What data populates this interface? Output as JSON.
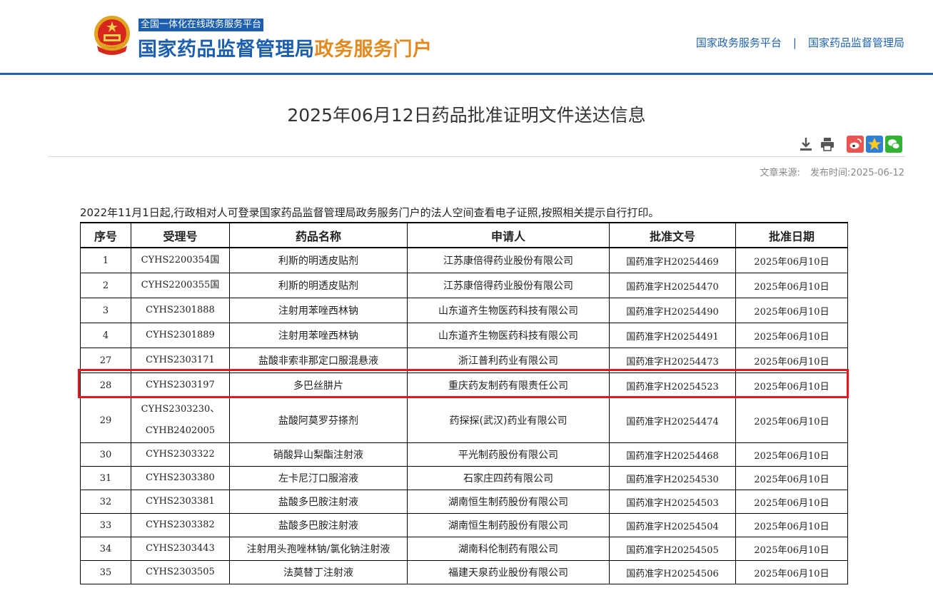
{
  "header": {
    "portal_tag": "全国一体化在线政务服务平台",
    "site_name_blue": "国家药品监督管理局",
    "site_name_orange": "政务服务门户",
    "links": [
      "国家政务服务平台",
      "国家药品监督管理局"
    ],
    "link_separator": "|"
  },
  "colors": {
    "brand_blue": "#1c5fb0",
    "accent_orange": "#e38a1e",
    "highlight_red": "#e8161c"
  },
  "article": {
    "title": "2025年06月12日药品批准证明文件送达信息",
    "source_label": "文章来源:",
    "published_label": "发布时间:",
    "published_date": "2025-06-12",
    "share_icons": [
      "download-icon",
      "print-icon",
      "weibo-icon",
      "qzone-icon",
      "wechat-icon"
    ]
  },
  "notice": "2022年11月1日起,行政相对人可登录国家药品监督管理局政务服务门户的法人空间查看电子证照,按照相关提示自行打印。",
  "table": {
    "headers": [
      "序号",
      "受理号",
      "药品名称",
      "申请人",
      "批准文号",
      "批准日期"
    ],
    "rows": [
      [
        "1",
        "CYHS2200354国",
        "利斯的明透皮贴剂",
        "江苏康倍得药业股份有限公司",
        "国药准字H20254469",
        "2025年06月10日"
      ],
      [
        "2",
        "CYHS2200355国",
        "利斯的明透皮贴剂",
        "江苏康倍得药业股份有限公司",
        "国药准字H20254470",
        "2025年06月10日"
      ],
      [
        "3",
        "CYHS2301888",
        "注射用苯唑西林钠",
        "山东道齐生物医药科技有限公司",
        "国药准字H20254490",
        "2025年06月10日"
      ],
      [
        "4",
        "CYHS2301889",
        "注射用苯唑西林钠",
        "山东道齐生物医药科技有限公司",
        "国药准字H20254491",
        "2025年06月10日"
      ],
      [
        "27",
        "CYHS2303171",
        "盐酸非索非那定口服混悬液",
        "浙江普利药业有限公司",
        "国药准字H20254473",
        "2025年06月10日"
      ],
      [
        "28",
        "CYHS2303197",
        "多巴丝肼片",
        "重庆药友制药有限责任公司",
        "国药准字H20254523",
        "2025年06月10日"
      ],
      [
        "29",
        "CYHS2303230、\nCYHB2402005",
        "盐酸阿莫罗芬搽剂",
        "药探探(武汉)药业有限公司",
        "国药准字H20254474",
        "2025年06月10日"
      ],
      [
        "30",
        "CYHS2303322",
        "硝酸异山梨酯注射液",
        "平光制药股份有限公司",
        "国药准字H20254468",
        "2025年06月10日"
      ],
      [
        "31",
        "CYHS2303380",
        "左卡尼汀口服溶液",
        "石家庄四药有限公司",
        "国药准字H20254530",
        "2025年06月10日"
      ],
      [
        "32",
        "CYHS2303381",
        "盐酸多巴胺注射液",
        "湖南恒生制药股份有限公司",
        "国药准字H20254503",
        "2025年06月10日"
      ],
      [
        "33",
        "CYHS2303382",
        "盐酸多巴胺注射液",
        "湖南恒生制药股份有限公司",
        "国药准字H20254504",
        "2025年06月10日"
      ],
      [
        "34",
        "CYHS2303443",
        "注射用头孢唑林钠/氯化钠注射液",
        "湖南科伦制药有限公司",
        "国药准字H20254505",
        "2025年06月10日"
      ],
      [
        "35",
        "CYHS2303505",
        "法莫替丁注射液",
        "福建天泉药业股份有限公司",
        "国药准字H20254506",
        "2025年06月10日"
      ]
    ]
  }
}
